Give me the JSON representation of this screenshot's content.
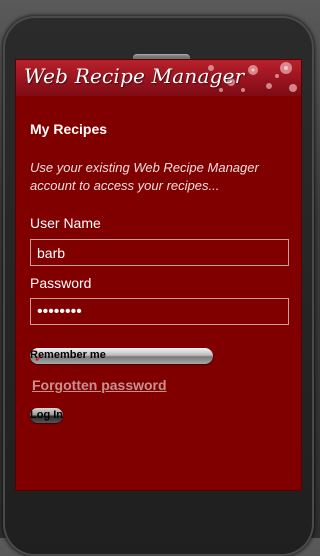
{
  "app": {
    "logo_text": "Web Recipe Manager"
  },
  "page": {
    "heading": "My Recipes",
    "intro": "Use your existing Web Recipe Manager account to access your recipes..."
  },
  "form": {
    "username_label": "User Name",
    "username_value": "barb",
    "password_label": "Password",
    "password_value": "••••••••",
    "remember_label": "Remember me",
    "remember_checked": true,
    "forgot_label": "Forgotten password",
    "login_label": "Log In"
  },
  "colors": {
    "screen_bg": "#800000",
    "banner": "#9b1520",
    "link": "#c89090"
  }
}
